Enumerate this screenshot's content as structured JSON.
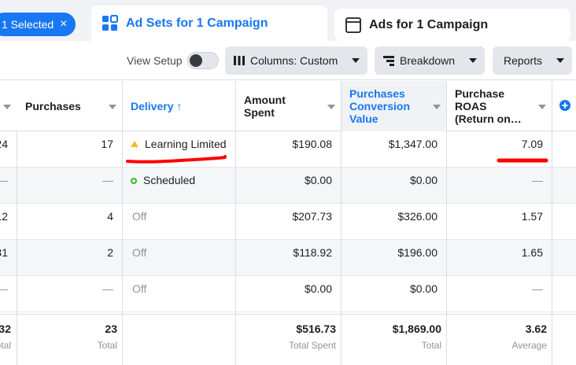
{
  "topbar": {
    "selected_label": "1 Selected",
    "selected_close": "×",
    "tab_adsets": "Ad Sets for 1 Campaign",
    "tab_ads": "Ads for 1 Campaign"
  },
  "toolbar": {
    "view_setup": "View Setup",
    "view_setup_on": false,
    "columns_label": "Columns: Custom",
    "breakdown_label": "Breakdown",
    "reports_label": "Reports"
  },
  "table": {
    "headers": {
      "purchases": "Purchases",
      "delivery": "Delivery ↑",
      "amount_spent": [
        "Amount",
        "Spent"
      ],
      "conversion_value": [
        "Purchases",
        "Conversion",
        "Value"
      ],
      "roas": [
        "Purchase",
        "ROAS",
        "(Return on…"
      ]
    },
    "rows": [
      {
        "left": "24",
        "purchases": "17",
        "delivery": "Learning Limited",
        "delivery_icon": "warning-triangle",
        "amount": "$190.08",
        "value": "$1,347.00",
        "roas": "7.09"
      },
      {
        "left": "—",
        "purchases": "—",
        "delivery": "Scheduled",
        "delivery_icon": "scheduled-circle",
        "amount": "$0.00",
        "value": "$0.00",
        "roas": "—"
      },
      {
        "left": "12",
        "purchases": "4",
        "delivery": "Off",
        "delivery_icon": "",
        "amount": "$207.73",
        "value": "$326.00",
        "roas": "1.57"
      },
      {
        "left": "31",
        "purchases": "2",
        "delivery": "Off",
        "delivery_icon": "",
        "amount": "$118.92",
        "value": "$196.00",
        "roas": "1.65"
      },
      {
        "left": "—",
        "purchases": "—",
        "delivery": "Off",
        "delivery_icon": "",
        "amount": "$0.00",
        "value": "$0.00",
        "roas": "—"
      }
    ],
    "totals": {
      "left_value": "32",
      "left_label": "otal",
      "purchases_value": "23",
      "purchases_label": "Total",
      "amount_value": "$516.73",
      "amount_label": "Total Spent",
      "value_value": "$1,869.00",
      "value_label": "Total",
      "roas_value": "3.62",
      "roas_label": "Average"
    }
  },
  "colors": {
    "accent": "#1877f2",
    "annotation": "#ff0000",
    "warning": "#f7b928",
    "scheduled": "#42b72a"
  }
}
